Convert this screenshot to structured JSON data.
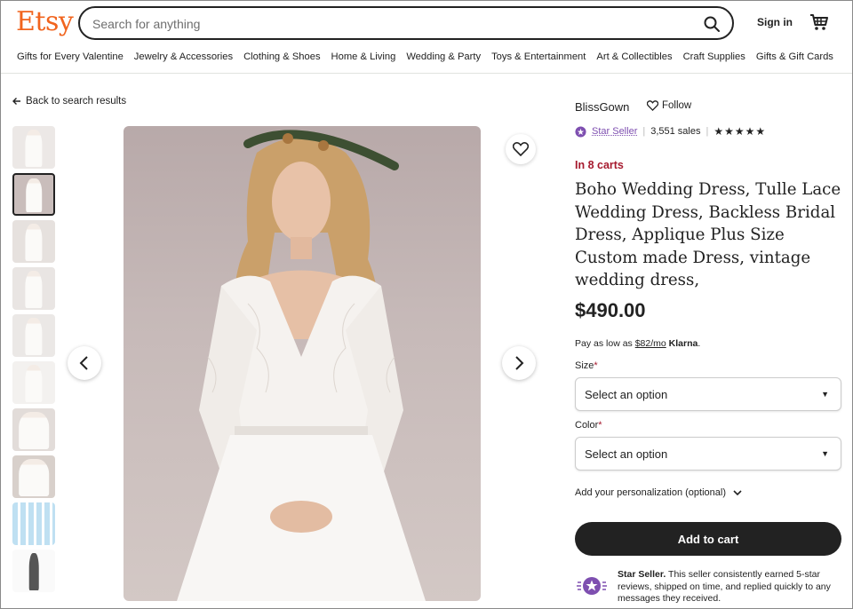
{
  "header": {
    "logo": "Etsy",
    "search_placeholder": "Search for anything",
    "sign_in": "Sign in",
    "categories": [
      "Gifts for Every Valentine",
      "Jewelry & Accessories",
      "Clothing & Shoes",
      "Home & Living",
      "Wedding & Party",
      "Toys & Entertainment",
      "Art & Collectibles",
      "Craft Supplies",
      "Gifts & Gift Cards"
    ]
  },
  "nav": {
    "back": "Back to search results"
  },
  "gallery": {
    "thumbnail_count": 10,
    "active_index": 1
  },
  "shop": {
    "name": "BlissGown",
    "follow": "Follow",
    "star_seller": "Star Seller",
    "sales": "3,551 sales",
    "stars": "★★★★★",
    "rating": 5
  },
  "listing": {
    "in_carts": "In 8 carts",
    "title": "Boho Wedding Dress, Tulle Lace Wedding Dress, Backless Bridal Dress, Applique Plus Size Custom made Dress, vintage wedding dress,",
    "price": "$490.00",
    "klarna_prefix": "Pay as low as ",
    "klarna_amount": "$82/mo",
    "klarna_brand": "Klarna",
    "klarna_suffix": "."
  },
  "options": {
    "size_label": "Size",
    "size_value": "Select an option",
    "color_label": "Color",
    "color_value": "Select an option",
    "required_mark": "*"
  },
  "personalization": "Add your personalization (optional)",
  "add_to_cart": "Add to cart",
  "star_seller_info": {
    "bold": "Star Seller.",
    "text": " This seller consistently earned 5-star reviews, shipped on time, and replied quickly to any messages they received."
  },
  "colors": {
    "brand": "#f1641e",
    "accent_purple": "#7e4fb0",
    "cart_red": "#a61a2e",
    "button_dark": "#222222"
  }
}
